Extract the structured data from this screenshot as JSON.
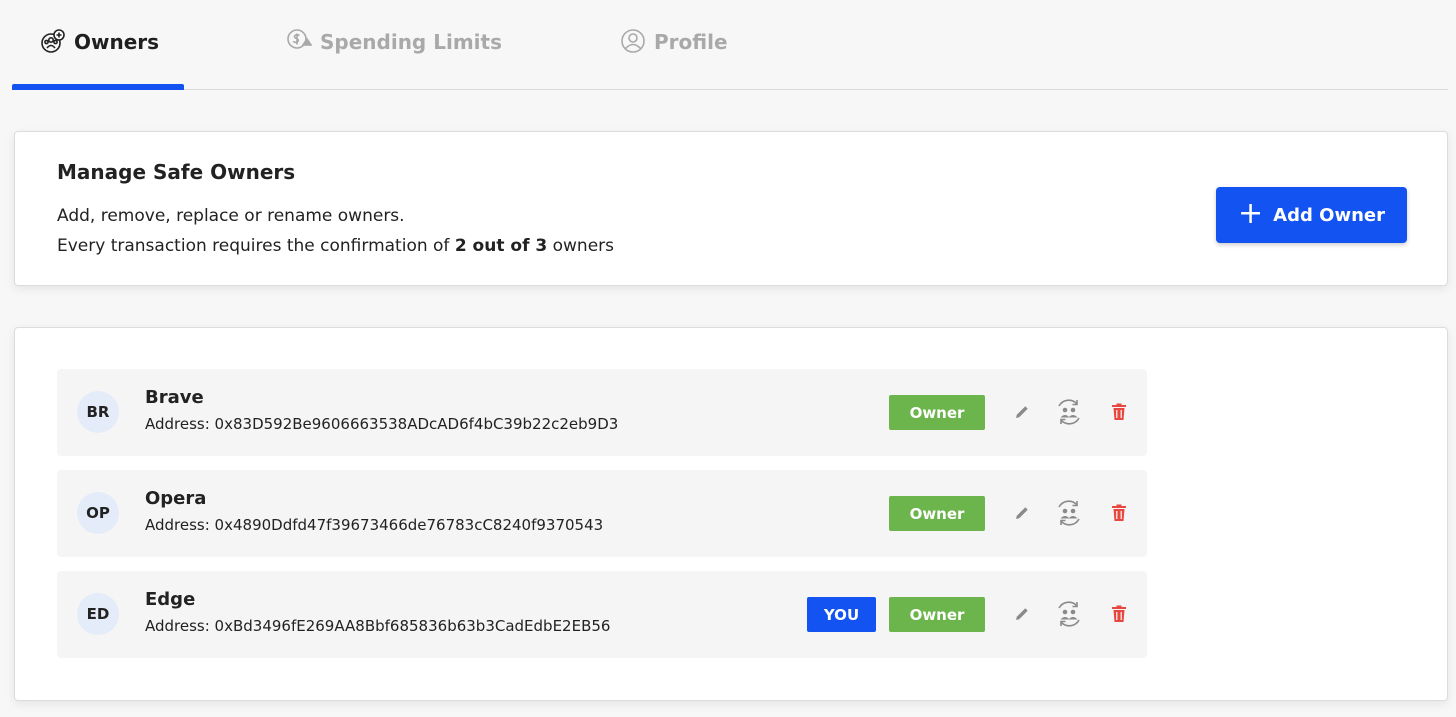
{
  "tabs": [
    {
      "label": "Owners",
      "icon": "owners-icon",
      "active": true
    },
    {
      "label": "Spending Limits",
      "icon": "spending-limits-icon",
      "active": false
    },
    {
      "label": "Profile",
      "icon": "profile-icon",
      "active": false
    }
  ],
  "manage": {
    "title": "Manage Safe Owners",
    "line1": "Add, remove, replace or rename owners.",
    "line2_prefix": "Every transaction requires the confirmation of ",
    "line2_bold": "2 out of 3",
    "line2_suffix": " owners",
    "add_button_label": "Add Owner"
  },
  "owners": [
    {
      "initials": "BR",
      "name": "Brave",
      "address": "Address: 0x83D592Be9606663538ADcAD6f4bC39b22c2eb9D3",
      "role": "Owner",
      "you": ""
    },
    {
      "initials": "OP",
      "name": "Opera",
      "address": "Address: 0x4890Ddfd47f39673466de76783cC8240f9370543",
      "role": "Owner",
      "you": ""
    },
    {
      "initials": "ED",
      "name": "Edge",
      "address": "Address: 0xBd3496fE269AA8Bbf685836b63b3CadEdbE2EB56",
      "role": "Owner",
      "you": "YOU"
    }
  ],
  "colors": {
    "accent": "#1353f1",
    "owner_badge": "#6cb54c",
    "delete": "#e8473f",
    "muted_icon": "#8a8a8a"
  }
}
